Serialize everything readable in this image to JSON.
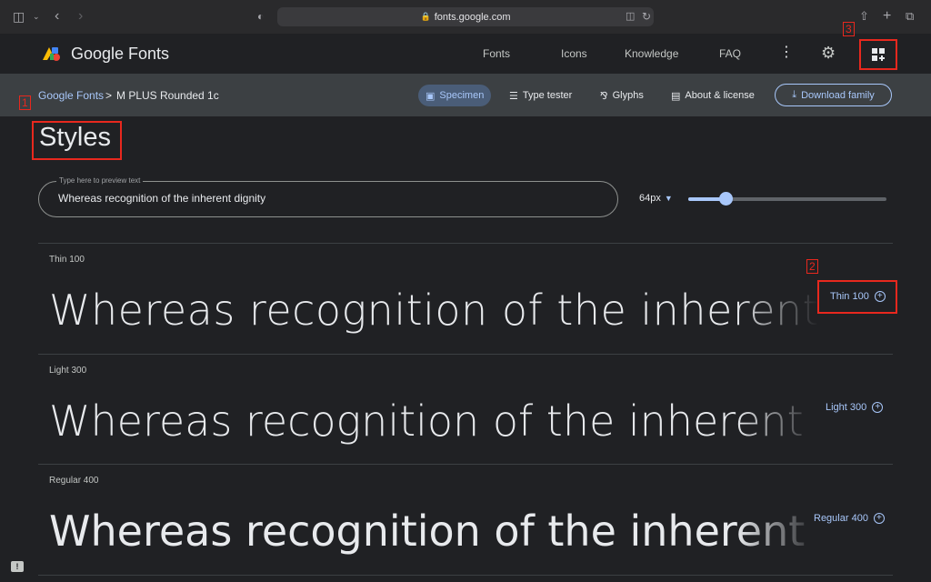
{
  "browser": {
    "url": "fonts.google.com"
  },
  "header": {
    "brand": "Google Fonts",
    "nav": [
      "Fonts",
      "Icons",
      "Knowledge",
      "FAQ"
    ]
  },
  "breadcrumb": {
    "root": "Google Fonts",
    "separator": ">",
    "current": "M PLUS Rounded 1c"
  },
  "tabs": [
    {
      "label": "Specimen",
      "icon": "specimen-icon",
      "active": true
    },
    {
      "label": "Type tester",
      "icon": "sliders-icon",
      "active": false
    },
    {
      "label": "Glyphs",
      "icon": "glyphs-icon",
      "active": false
    },
    {
      "label": "About & license",
      "icon": "article-icon",
      "active": false
    }
  ],
  "download_label": "Download family",
  "main": {
    "section_title": "Styles",
    "preview_legend": "Type here to preview text",
    "preview_text": "Whereas recognition of the inherent dignity",
    "font_size": "64px",
    "slider_fraction": 0.19
  },
  "styles": [
    {
      "name": "Thin 100",
      "sample": "Whereas recognition of the inherent dignity",
      "button": "Thin 100",
      "weight": 100
    },
    {
      "name": "Light 300",
      "sample": "Whereas recognition of the inherent dignity",
      "button": "Light 300",
      "weight": 300
    },
    {
      "name": "Regular 400",
      "sample": "Whereas recognition of the inherent dignity",
      "button": "Regular 400",
      "weight": 400
    }
  ],
  "annotations": [
    "1",
    "2",
    "3"
  ],
  "colors": {
    "accent": "#a8c7fa",
    "annotation": "#e8281e",
    "background": "#202124"
  }
}
